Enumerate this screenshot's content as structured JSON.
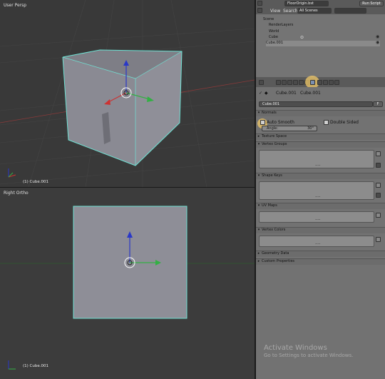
{
  "top_view": {
    "label": "User Persp",
    "object": "(1) Cube.001"
  },
  "bottom_view": {
    "label": "Right Ortho",
    "object": "(1) Cube.001"
  },
  "header": {
    "file": "FloorOrigin.bst",
    "run_script": "Run Script"
  },
  "outliner_header": {
    "view": "View",
    "search": "Search",
    "scenes": "All Scenes"
  },
  "outliner": {
    "items": [
      "Scene",
      "RenderLayers",
      "World",
      "Cube",
      "Cube.001"
    ]
  },
  "properties": {
    "breadcrumb": [
      "Cube.001",
      "Cube.001"
    ],
    "name_field": "Cube.001",
    "name_suffix": "F",
    "normals_title": "Normals",
    "auto_smooth": "Auto Smooth",
    "double_sided": "Double Sided",
    "angle_label": "Angle:",
    "angle_value": "30°",
    "texture_space": "Texture Space",
    "vertex_groups": "Vertex Groups",
    "shape_keys": "Shape Keys",
    "uv_maps": "UV Maps",
    "vertex_colors": "Vertex Colors",
    "geometry_data": "Geometry Data",
    "custom_properties": "Custom Properties",
    "list_dots": "...."
  },
  "watermark": {
    "title": "Activate Windows",
    "subtitle": "Go to Settings to activate Windows."
  },
  "colors": {
    "selection_outline": "#6fe2d4",
    "highlight": "#f2c96a",
    "axis_x": "#cc3333",
    "axis_z": "#2a38c8",
    "axis_y": "#33b044"
  }
}
